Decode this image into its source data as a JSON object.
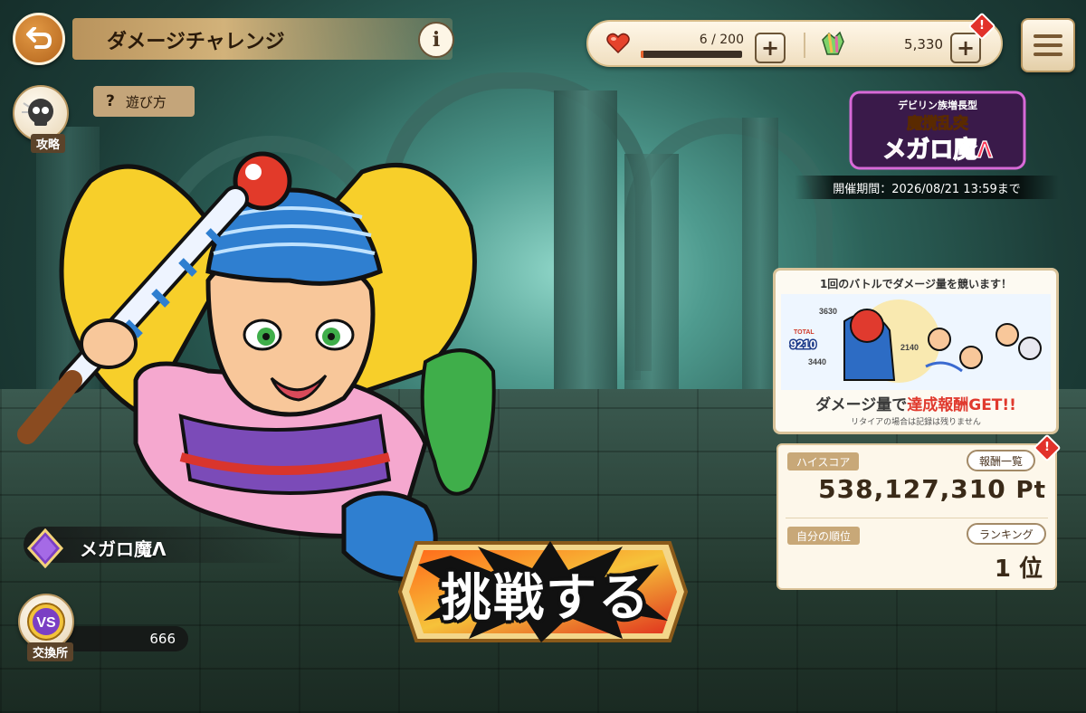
{
  "header": {
    "title": "ダメージチャレンジ",
    "back_icon": "back-arrow-icon",
    "info_label": "i",
    "how_to_label": "遊び方",
    "how_to_icon": "?"
  },
  "resources": {
    "stamina_text": "6 / 200",
    "stamina_fraction": 0.03,
    "gems_value": "5,330",
    "plus_label": "+",
    "alert_mark": "!"
  },
  "side": {
    "strategy_label": "攻略",
    "exchange_label": "交換所",
    "exchange_icon_text": "VS",
    "exchange_count": "666"
  },
  "boss": {
    "name": "メガロ魔Λ"
  },
  "event": {
    "logo_sub": "デビリン族増長型",
    "logo_main": "魔撹乱突",
    "logo_name": "メガロ魔Λ",
    "period": "開催期間：2026/08/21 13:59まで"
  },
  "banner": {
    "headline": "1回のバトルでダメージ量を競います！",
    "cta_prefix": "ダメージ量で",
    "cta_highlight": "達成報酬GET!!",
    "note": "リタイアの場合は記録は残りません",
    "numbers": [
      "3630",
      "TOTAL",
      "9210",
      "3440",
      "2140"
    ]
  },
  "score": {
    "highscore_label": "ハイスコア",
    "rewards_button": "報酬一覧",
    "highscore_value": "538,127,310",
    "highscore_unit": "Pt",
    "rank_label": "自分の順位",
    "ranking_button": "ランキング",
    "rank_value": "1 位"
  },
  "challenge": {
    "label": "挑戦する"
  },
  "colors": {
    "accent_orange": "#c9762c",
    "alert_red": "#e2322b",
    "panel_bg": "#fdf7ea",
    "cta_red": "#e03a2e"
  }
}
